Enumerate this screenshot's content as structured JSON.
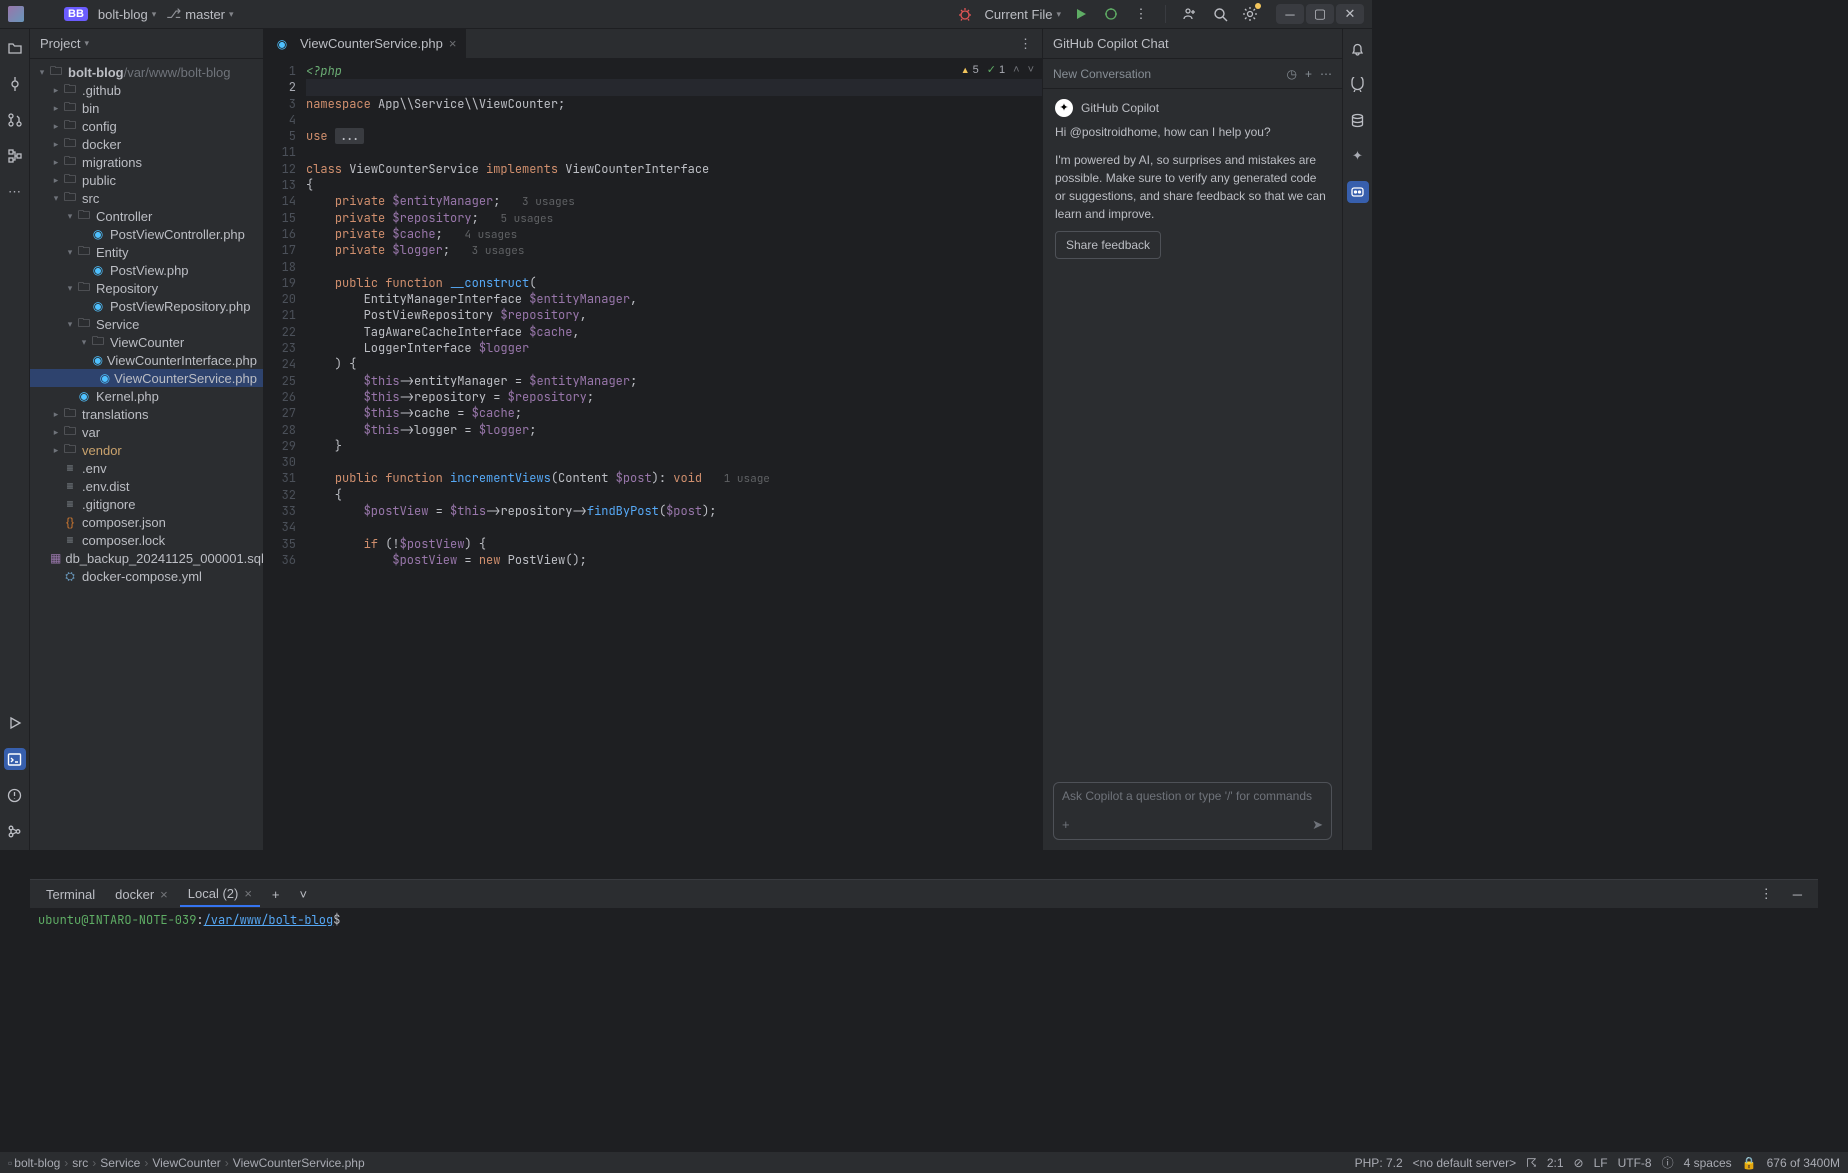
{
  "titlebar": {
    "project_badge": "BB",
    "project_name": "bolt-blog",
    "branch_name": "master",
    "run_config": "Current File"
  },
  "project_panel": {
    "title": "Project"
  },
  "tree": {
    "root": "bolt-blog",
    "root_path": "/var/www/bolt-blog",
    "nodes": [
      {
        "d": 1,
        "t": "folder",
        "exp": false,
        "n": ".github"
      },
      {
        "d": 1,
        "t": "folder",
        "exp": false,
        "n": "bin"
      },
      {
        "d": 1,
        "t": "folder",
        "exp": false,
        "n": "config"
      },
      {
        "d": 1,
        "t": "folder",
        "exp": false,
        "n": "docker"
      },
      {
        "d": 1,
        "t": "folder",
        "exp": false,
        "n": "migrations"
      },
      {
        "d": 1,
        "t": "folder",
        "exp": false,
        "n": "public"
      },
      {
        "d": 1,
        "t": "folder",
        "exp": true,
        "n": "src"
      },
      {
        "d": 2,
        "t": "folder",
        "exp": true,
        "n": "Controller"
      },
      {
        "d": 3,
        "t": "php",
        "n": "PostViewController.php"
      },
      {
        "d": 2,
        "t": "folder",
        "exp": true,
        "n": "Entity"
      },
      {
        "d": 3,
        "t": "php",
        "n": "PostView.php"
      },
      {
        "d": 2,
        "t": "folder",
        "exp": true,
        "n": "Repository"
      },
      {
        "d": 3,
        "t": "php",
        "n": "PostViewRepository.php"
      },
      {
        "d": 2,
        "t": "folder",
        "exp": true,
        "n": "Service"
      },
      {
        "d": 3,
        "t": "folder",
        "exp": true,
        "n": "ViewCounter"
      },
      {
        "d": 4,
        "t": "php",
        "n": "ViewCounterInterface.php",
        "iface": true
      },
      {
        "d": 4,
        "t": "php",
        "n": "ViewCounterService.php",
        "sel": true
      },
      {
        "d": 2,
        "t": "php",
        "n": "Kernel.php"
      },
      {
        "d": 1,
        "t": "folder",
        "exp": false,
        "n": "translations"
      },
      {
        "d": 1,
        "t": "folder",
        "exp": false,
        "n": "var"
      },
      {
        "d": 1,
        "t": "folder",
        "exp": false,
        "n": "vendor",
        "lib": true
      },
      {
        "d": 1,
        "t": "file",
        "n": ".env"
      },
      {
        "d": 1,
        "t": "file",
        "n": ".env.dist"
      },
      {
        "d": 1,
        "t": "file",
        "n": ".gitignore"
      },
      {
        "d": 1,
        "t": "json",
        "n": "composer.json"
      },
      {
        "d": 1,
        "t": "file",
        "n": "composer.lock"
      },
      {
        "d": 1,
        "t": "sql",
        "n": "db_backup_20241125_000001.sql"
      },
      {
        "d": 1,
        "t": "yml",
        "n": "docker-compose.yml"
      }
    ]
  },
  "tabs": [
    {
      "name": "ViewCounterService.php"
    }
  ],
  "inspections": {
    "warn": "5",
    "ok": "1"
  },
  "code_lines": [
    {
      "n": 1,
      "h": "<span class='php-open'>&lt;?php</span>"
    },
    {
      "n": 2,
      "h": "",
      "hl": true
    },
    {
      "n": 3,
      "h": "<span class='kw'>namespace</span> <span class='cls'>App\\\\Service\\\\ViewCounter</span>;"
    },
    {
      "n": 4,
      "h": ""
    },
    {
      "n": 5,
      "h": "<span class='kw'>use</span> <span class='collapsed'>...</span>"
    },
    {
      "n": 11,
      "h": ""
    },
    {
      "n": 12,
      "h": "<span class='kw'>class</span> <span class='cls'>ViewCounterService</span> <span class='kw'>implements</span> <span class='cls'>ViewCounterInterface</span>"
    },
    {
      "n": 13,
      "h": "{"
    },
    {
      "n": 14,
      "h": "    <span class='kw'>private</span> <span class='var'>$entityManager</span>;   <span class='usage-hint'>3 usages</span>"
    },
    {
      "n": 15,
      "h": "    <span class='kw'>private</span> <span class='var'>$repository</span>;   <span class='usage-hint'>5 usages</span>"
    },
    {
      "n": 16,
      "h": "    <span class='kw'>private</span> <span class='var'>$cache</span>;   <span class='usage-hint'>4 usages</span>"
    },
    {
      "n": 17,
      "h": "    <span class='kw'>private</span> <span class='var'>$logger</span>;   <span class='usage-hint'>3 usages</span>"
    },
    {
      "n": 18,
      "h": ""
    },
    {
      "n": 19,
      "h": "    <span class='kw'>public</span> <span class='kw'>function</span> <span class='fn'>__construct</span>("
    },
    {
      "n": 20,
      "h": "        <span class='cls'>EntityManagerInterface</span> <span class='var'>$entityManager</span>,"
    },
    {
      "n": 21,
      "h": "        <span class='cls'>PostViewRepository</span> <span class='var'>$repository</span>,"
    },
    {
      "n": 22,
      "h": "        <span class='cls'>TagAwareCacheInterface</span> <span class='var'>$cache</span>,"
    },
    {
      "n": 23,
      "h": "        <span class='cls'>LoggerInterface</span> <span class='var'>$logger</span>"
    },
    {
      "n": 24,
      "h": "    ) {"
    },
    {
      "n": 25,
      "h": "        <span class='var'>$this</span>-&gt;<span class='param'>entityManager</span> = <span class='var'>$entityManager</span>;"
    },
    {
      "n": 26,
      "h": "        <span class='var'>$this</span>-&gt;<span class='param'>repository</span> = <span class='var'>$repository</span>;"
    },
    {
      "n": 27,
      "h": "        <span class='var'>$this</span>-&gt;<span class='param'>cache</span> = <span class='var'>$cache</span>;"
    },
    {
      "n": 28,
      "h": "        <span class='var'>$this</span>-&gt;<span class='param'>logger</span> = <span class='var'>$logger</span>;"
    },
    {
      "n": 29,
      "h": "    }"
    },
    {
      "n": 30,
      "h": ""
    },
    {
      "n": 31,
      "h": "    <span class='kw'>public</span> <span class='kw'>function</span> <span class='fn'>incrementViews</span>(<span class='cls'>Content</span> <span class='var'>$post</span>): <span class='type'>void</span>   <span class='usage-hint'>1 usage</span>"
    },
    {
      "n": 32,
      "h": "    {"
    },
    {
      "n": 33,
      "h": "        <span class='var'>$postView</span> = <span class='var'>$this</span>-&gt;<span class='param'>repository</span>-&gt;<span class='fn'>findByPost</span>(<span class='var'>$post</span>);"
    },
    {
      "n": 34,
      "h": ""
    },
    {
      "n": 35,
      "h": "        <span class='kw'>if</span> (!<span class='var'>$postView</span>) {"
    },
    {
      "n": 36,
      "h": "            <span class='var'>$postView</span> = <span class='kw'>new</span> <span class='cls'>PostView</span>();"
    }
  ],
  "copilot": {
    "title": "GitHub Copilot Chat",
    "new_conv": "New Conversation",
    "name": "GitHub Copilot",
    "greeting_pre": "Hi ",
    "mention": "@positroidhome",
    "greeting_post": ", how can I help you?",
    "disclaimer": "I'm powered by AI, so surprises and mistakes are possible. Make sure to verify any generated code or suggestions, and share feedback so that we can learn and improve.",
    "share_btn": "Share feedback",
    "placeholder": "Ask Copilot a question or type '/' for commands"
  },
  "terminal": {
    "title": "Terminal",
    "tabs": [
      {
        "n": "docker"
      },
      {
        "n": "Local (2)",
        "active": true
      }
    ],
    "prompt_user": "ubuntu@INTARO-NOTE-039",
    "prompt_path": "/var/www/bolt-blog"
  },
  "breadcrumbs": [
    "bolt-blog",
    "src",
    "Service",
    "ViewCounter",
    "ViewCounterService.php"
  ],
  "status": {
    "php": "PHP: 7.2",
    "server": "<no default server>",
    "pos": "2:1",
    "eol": "LF",
    "enc": "UTF-8",
    "indent": "4 spaces",
    "mem": "676 of 3400M"
  }
}
